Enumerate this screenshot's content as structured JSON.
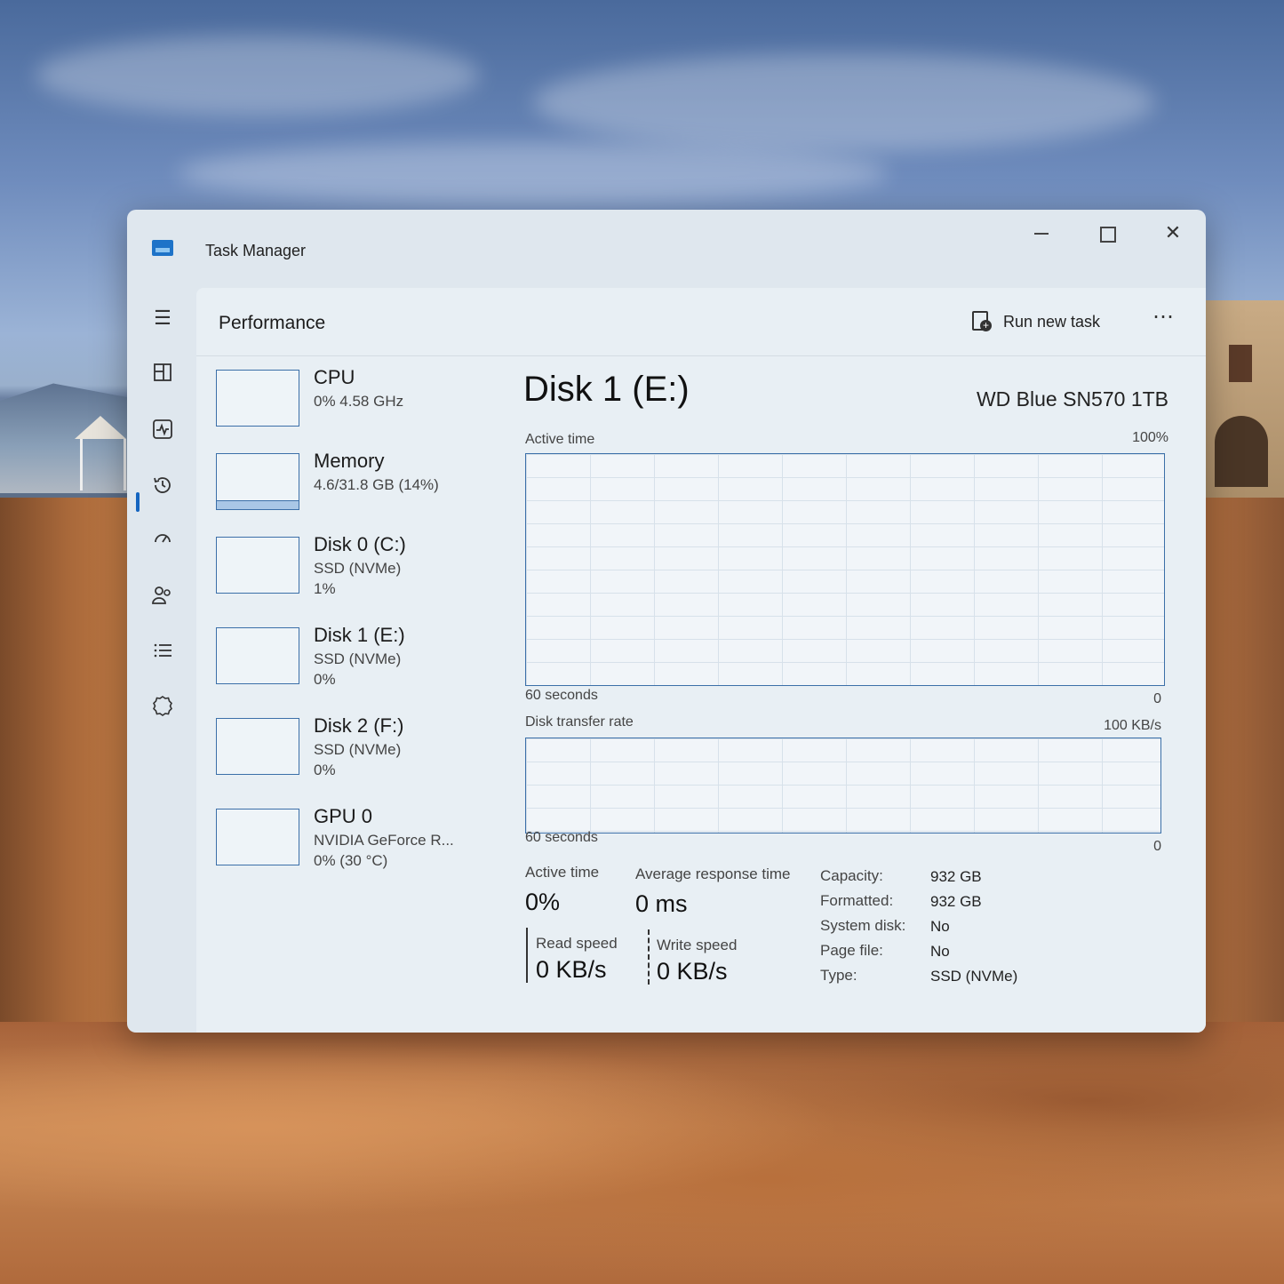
{
  "window": {
    "title": "Task Manager",
    "controls": {
      "minimize": "minimize",
      "maximize": "maximize",
      "close": "✕"
    }
  },
  "header": {
    "title": "Performance",
    "run_new_task": "Run new task",
    "more": "⋯"
  },
  "nav": {
    "menu": "☰",
    "items": [
      "processes-icon",
      "performance-icon",
      "app-history-icon",
      "startup-apps-icon",
      "users-icon",
      "details-icon",
      "services-icon"
    ],
    "settings": "⚙"
  },
  "devices": [
    {
      "name": "CPU",
      "line1": "0% 4.58 GHz",
      "line2": "",
      "usage": 0
    },
    {
      "name": "Memory",
      "line1": "4.6/31.8 GB (14%)",
      "line2": "",
      "usage": 0.14
    },
    {
      "name": "Disk 0 (C:)",
      "line1": "SSD (NVMe)",
      "line2": "1%",
      "usage": 0.01
    },
    {
      "name": "Disk 1 (E:)",
      "line1": "SSD (NVMe)",
      "line2": "0%",
      "usage": 0
    },
    {
      "name": "Disk 2 (F:)",
      "line1": "SSD (NVMe)",
      "line2": "0%",
      "usage": 0
    },
    {
      "name": "GPU 0",
      "line1": "NVIDIA GeForce R...",
      "line2": "0% (30 °C)",
      "usage": 0
    }
  ],
  "detail": {
    "title": "Disk 1 (E:)",
    "model": "WD Blue SN570 1TB",
    "active_time_graph": {
      "label": "Active time",
      "max": "100%",
      "duration": "60 seconds",
      "min": "0"
    },
    "transfer_graph": {
      "label": "Disk transfer rate",
      "max": "100 KB/s",
      "duration": "60 seconds",
      "min": "0"
    },
    "stats": {
      "active_time_label": "Active time",
      "active_time_value": "0%",
      "avg_response_label": "Average response time",
      "avg_response_value": "0 ms",
      "read_speed_label": "Read speed",
      "read_speed_value": "0 KB/s",
      "write_speed_label": "Write speed",
      "write_speed_value": "0 KB/s"
    },
    "properties": [
      {
        "key": "Capacity:",
        "value": "932 GB"
      },
      {
        "key": "Formatted:",
        "value": "932 GB"
      },
      {
        "key": "System disk:",
        "value": "No"
      },
      {
        "key": "Page file:",
        "value": "No"
      },
      {
        "key": "Type:",
        "value": "SSD (NVMe)"
      }
    ]
  },
  "colors": {
    "accent": "#1565c0",
    "graph_border": "#3b6fa8",
    "memory_fill": "#a9c7e6"
  }
}
